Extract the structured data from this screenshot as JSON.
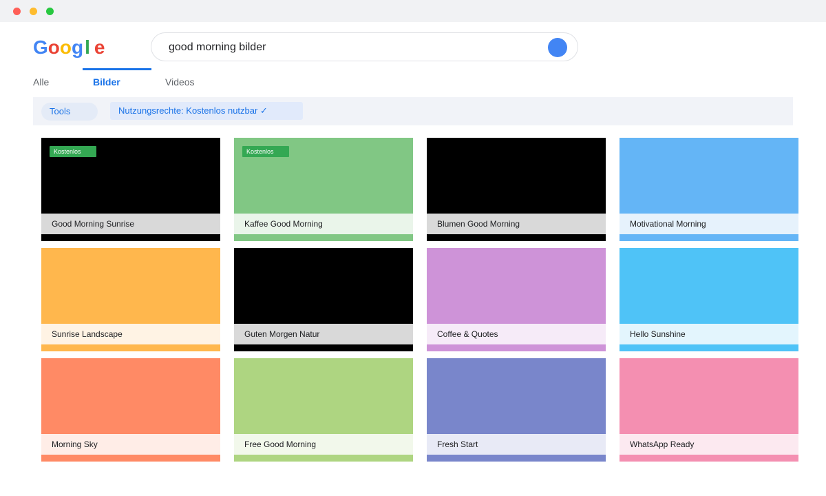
{
  "logo": {
    "letters": [
      "G",
      "o",
      "o",
      "g",
      "l",
      "e"
    ]
  },
  "search": {
    "query": "good morning bilder"
  },
  "tabs": [
    {
      "label": "Alle"
    },
    {
      "label": "Bilder"
    },
    {
      "label": "Videos"
    }
  ],
  "active_tab": "Bilder",
  "filters": {
    "tools_label": "Tools",
    "rights_label": "Nutzungsrechte: Kostenlos nutzbar ✓"
  },
  "colors": {
    "accent": "#1a73e8",
    "search_button": "#4285f4",
    "badge": "#34a853"
  },
  "results": [
    {
      "title": "Good Morning Sunrise",
      "badge": "Kostenlos",
      "image_color": "#000000",
      "caption_bg": "#d9d9d9"
    },
    {
      "title": "Kaffee Good Morning",
      "badge": "Kostenlos",
      "image_color": "#81c784",
      "caption_bg": "#eaf5ea"
    },
    {
      "title": "Blumen Good Morning",
      "badge": "",
      "image_color": "#000000",
      "caption_bg": "#d9d9d9"
    },
    {
      "title": "Motivational Morning",
      "badge": "",
      "image_color": "#64b5f6",
      "caption_bg": "#e6f2fc"
    },
    {
      "title": "Sunrise Landscape",
      "badge": "",
      "image_color": "#ffb74d",
      "caption_bg": "#fff3e4"
    },
    {
      "title": "Guten Morgen Natur",
      "badge": "",
      "image_color": "#000000",
      "caption_bg": "#d9d9d9"
    },
    {
      "title": "Coffee & Quotes",
      "badge": "",
      "image_color": "#ce93d8",
      "caption_bg": "#f6ebf8"
    },
    {
      "title": "Hello Sunshine",
      "badge": "",
      "image_color": "#4fc3f7",
      "caption_bg": "#e3f5fd"
    },
    {
      "title": "Morning Sky",
      "badge": "",
      "image_color": "#ff8a65",
      "caption_bg": "#ffede7"
    },
    {
      "title": "Free Good Morning",
      "badge": "",
      "image_color": "#aed581",
      "caption_bg": "#f2f8eb"
    },
    {
      "title": "Fresh Start",
      "badge": "",
      "image_color": "#7986cb",
      "caption_bg": "#e8eaf6"
    },
    {
      "title": "WhatsApp Ready",
      "badge": "",
      "image_color": "#f48fb1",
      "caption_bg": "#fce9f0"
    }
  ]
}
